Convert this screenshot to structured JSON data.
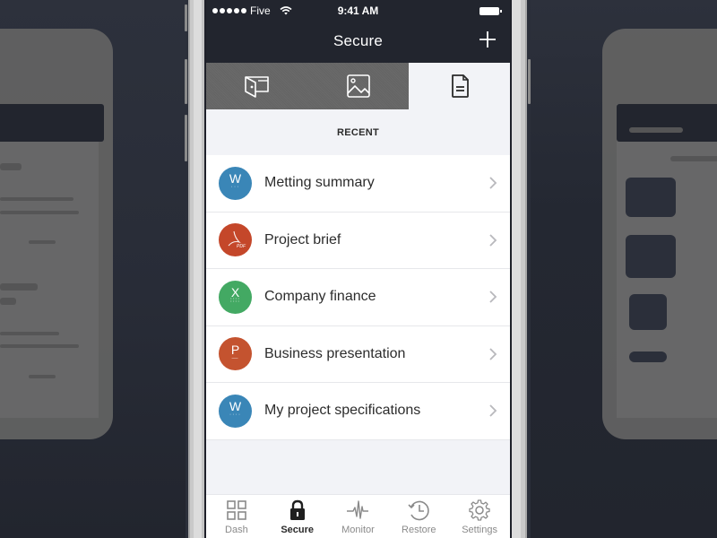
{
  "status_bar": {
    "carrier": "Five",
    "time": "9:41 AM",
    "signal_bars": 5
  },
  "nav": {
    "title": "Secure",
    "add_icon": "plus-icon"
  },
  "tabs": [
    {
      "name": "wallet",
      "icon": "wallet-icon",
      "active": false
    },
    {
      "name": "photos",
      "icon": "image-icon",
      "active": false
    },
    {
      "name": "documents",
      "icon": "document-icon",
      "active": true
    }
  ],
  "section": {
    "header": "RECENT"
  },
  "documents": [
    {
      "label": "Metting summary",
      "type": "W",
      "color": "#3a86b7"
    },
    {
      "label": "Project brief",
      "type": "PDF",
      "color": "#c4472a"
    },
    {
      "label": "Company finance",
      "type": "X",
      "color": "#43a963"
    },
    {
      "label": "Business presentation",
      "type": "P",
      "color": "#c4532f"
    },
    {
      "label": "My project specifications",
      "type": "W",
      "color": "#3a86b7"
    }
  ],
  "tab_bar": {
    "items": [
      {
        "label": "Dash",
        "icon": "grid-icon",
        "active": false
      },
      {
        "label": "Secure",
        "icon": "lock-icon",
        "active": true
      },
      {
        "label": "Monitor",
        "icon": "pulse-icon",
        "active": false
      },
      {
        "label": "Restore",
        "icon": "history-icon",
        "active": false
      },
      {
        "label": "Settings",
        "icon": "gear-icon",
        "active": false
      }
    ]
  },
  "colors": {
    "nav_bg": "#22252e",
    "screen_bg": "#f2f3f7",
    "tab_inactive_bg": "#6a6a6a",
    "word_blue": "#3a86b7",
    "pdf_red": "#c4472a",
    "excel_green": "#43a963",
    "ppt_orange": "#c4532f"
  }
}
